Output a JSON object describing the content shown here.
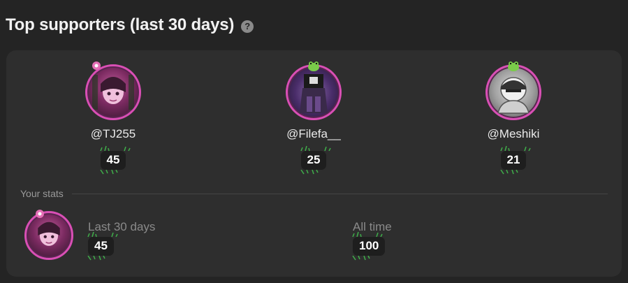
{
  "header": {
    "title": "Top supporters (last 30 days)",
    "help_icon": "?"
  },
  "supporters": [
    {
      "handle": "@TJ255",
      "count": "45",
      "avatar_colors": [
        "#7a2a60",
        "#3a1a30"
      ]
    },
    {
      "handle": "@Filefa__",
      "count": "25",
      "avatar_colors": [
        "#6a3d8a",
        "#2a1a3a"
      ]
    },
    {
      "handle": "@Meshiki",
      "count": "21",
      "avatar_colors": [
        "#9a9a9a",
        "#505050"
      ]
    }
  ],
  "your_stats": {
    "label": "Your stats",
    "last_30_label": "Last 30 days",
    "last_30_value": "45",
    "all_time_label": "All time",
    "all_time_value": "100"
  },
  "colors": {
    "background": "#242424",
    "card": "#2e2e2e",
    "avatar_ring": "#d94fb5",
    "sprout": "#3fae4a"
  }
}
